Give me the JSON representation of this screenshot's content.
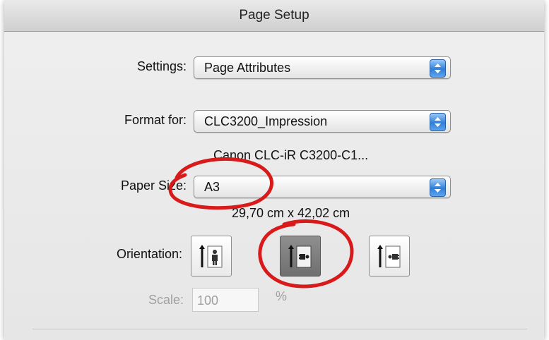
{
  "window": {
    "title": "Page Setup"
  },
  "settings": {
    "label": "Settings:",
    "value": "Page Attributes"
  },
  "format": {
    "label": "Format for:",
    "value": "CLC3200_Impression",
    "printer": "Canon CLC-iR C3200-C1..."
  },
  "paper": {
    "label": "Paper Size:",
    "value": "A3",
    "dimensions": "29,70 cm x 42,02 cm"
  },
  "orientation": {
    "label": "Orientation:",
    "options": [
      {
        "name": "portrait",
        "selected": false
      },
      {
        "name": "landscape-left",
        "selected": true
      },
      {
        "name": "landscape-right",
        "selected": false
      }
    ]
  },
  "scale": {
    "label": "Scale:",
    "value": "100",
    "unit": "%"
  },
  "colors": {
    "annotation": "#d91a1a",
    "popup_accent": "#2f7fd9",
    "selected_button": "#7a7a7a"
  }
}
